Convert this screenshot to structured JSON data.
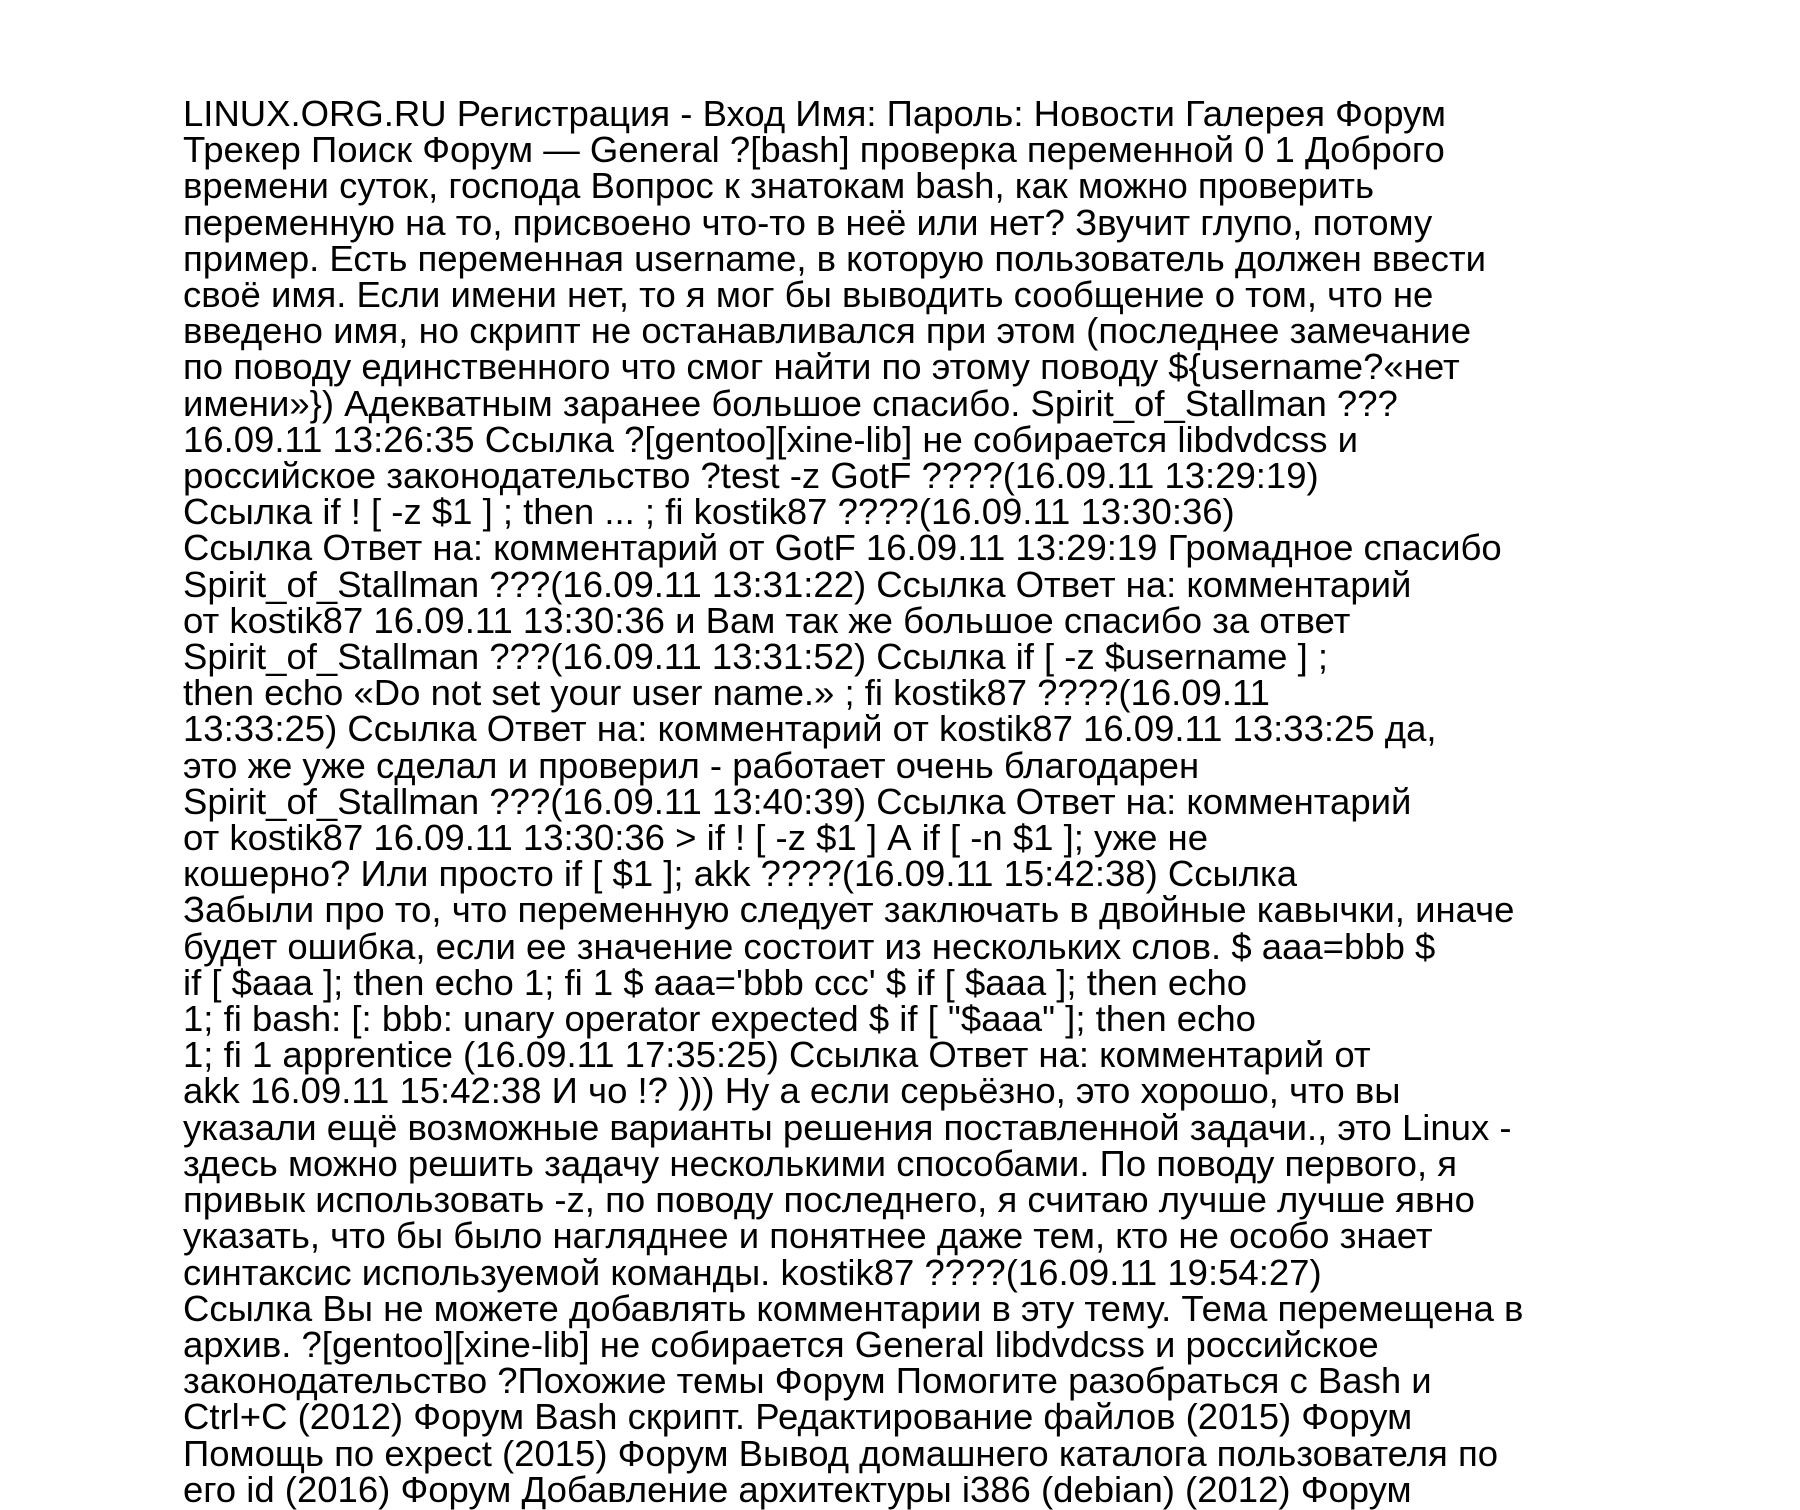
{
  "document": {
    "lines": [
      "LINUX.ORG.RU Регистрация - Вход Имя: Пароль: Новости Галерея Форум",
      "Трекер Поиск Форум — General ?[bash] проверка переменной 0 1 Доброго",
      "времени суток, господа Вопрос к знатокам bash, как можно проверить",
      "переменную на то, присвоено что-то в неё или нет? Звучит глупо, потому",
      "пример. Есть переменная username, в которую пользователь должен ввести",
      "своё имя. Если имени нет, то я мог бы выводить сообщение о том, что не",
      "введено имя, но скрипт не останавливался при этом (последнее замечание",
      "по поводу единственного что смог найти по этому поводу ${username?«нет",
      "имени»}) Адекватным заранее большое спасибо. Spirit_of_Stallman ???",
      "16.09.11 13:26:35 Ссылка ?[gentoo][xine-lib] не собирается libdvdcss и",
      "российское законодательство ?test -z GotF ????(16.09.11 13:29:19)",
      "Ссылка if ! [ -z $1 ] ; then ... ; fi kostik87 ????(16.09.11 13:30:36)",
      "Ссылка Ответ на: комментарий от GotF 16.09.11 13:29:19 Громадное спасибо",
      "Spirit_of_Stallman ???(16.09.11 13:31:22) Ссылка Ответ на: комментарий",
      "от kostik87 16.09.11 13:30:36 и Вам так же большое спасибо за ответ",
      "Spirit_of_Stallman ???(16.09.11 13:31:52) Ссылка if [ -z $username ] ;",
      "then echo «Do not set your user name.» ; fi kostik87 ????(16.09.11",
      "13:33:25) Ссылка Ответ на: комментарий от kostik87 16.09.11 13:33:25 да,",
      "это же уже сделал и проверил - работает очень благодарен",
      "Spirit_of_Stallman ???(16.09.11 13:40:39) Ссылка Ответ на: комментарий",
      "от kostik87 16.09.11 13:30:36 > if ! [ -z $1 ] А if [ -n $1 ]; уже не",
      "кошерно? Или просто if [ $1 ]; akk ????(16.09.11 15:42:38) Ссылка",
      "Забыли про то, что переменную следует заключать в двойные кавычки, иначе",
      "будет ошибка, если ее значение состоит из нескольких слов. $ aaa=bbb $",
      "if [ $aaa ]; then echo 1; fi 1 $ aaa='bbb ccc' $ if [ $aaa ]; then echo",
      "1; fi bash: [: bbb: unary operator expected $ if [ \"$aaa\" ]; then echo",
      "1; fi 1 apprentice (16.09.11 17:35:25) Ссылка Ответ на: комментарий от",
      "akk 16.09.11 15:42:38 И чо !? ))) Ну а если серьёзно, это хорошо, что вы",
      "указали ещё возможные варианты решения поставленной задачи., это Linux -",
      "здесь можно решить задачу несколькими способами. По поводу первого, я",
      "привык использовать -z, по поводу последнего, я считаю лучше лучше явно",
      "указать, что бы было нагляднее и понятнее даже тем, кто не особо знает",
      "синтаксис используемой команды. kostik87 ????(16.09.11 19:54:27)",
      "Ссылка Вы не можете добавлять комментарии в эту тему. Тема перемещена в",
      "архив. ?[gentoo][xine-lib] не собирается General libdvdcss и российское",
      "законодательство ?Похожие темы Форум Помогите разобраться с Bash и",
      "Ctrl+C (2012) Форум Bash скрипт. Редактирование файлов (2015) Форум",
      "Помощь по expect (2015) Форум Вывод домашнего каталога пользователя по",
      "его id (2016) Форум Добавление архитектуры i386 (debian) (2012) Форум"
    ]
  }
}
